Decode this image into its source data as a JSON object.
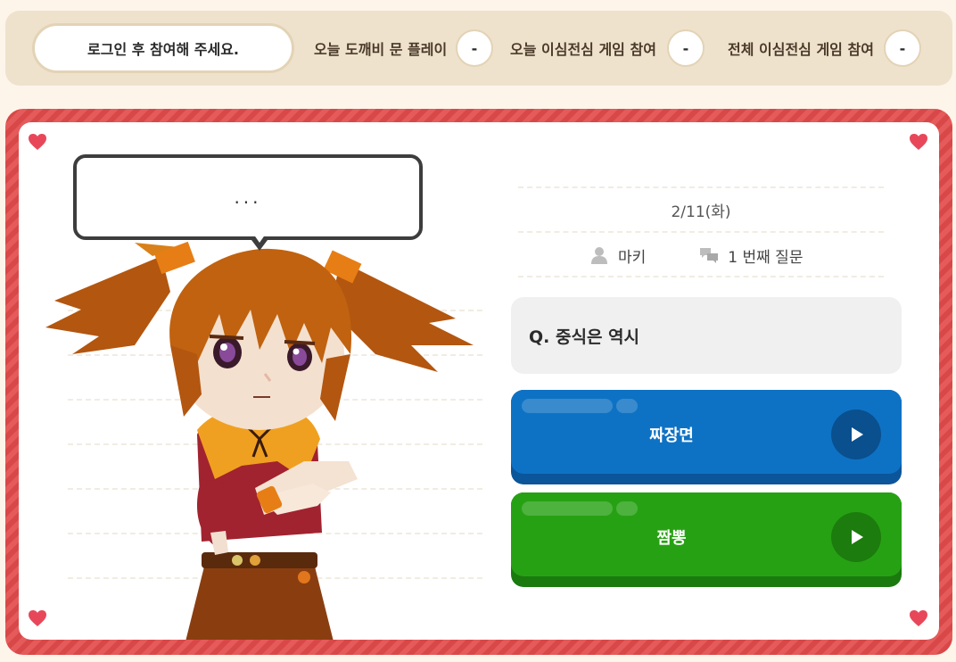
{
  "topbar": {
    "login_button": "로그인 후 참여해 주세요.",
    "stats": [
      {
        "label": "오늘 도깨비 문 플레이",
        "value": "-"
      },
      {
        "label": "오늘 이심전심 게임 참여",
        "value": "-"
      },
      {
        "label": "전체 이심전심 게임 참여",
        "value": "-"
      }
    ]
  },
  "speech": {
    "text": "..."
  },
  "quiz": {
    "date": "2/11(화)",
    "author": "마키",
    "question_number": "1 번째 질문",
    "question": "Q. 중식은 역시",
    "answers": [
      {
        "label": "짜장면",
        "color": "#0e72c4"
      },
      {
        "label": "짬뽕",
        "color": "#27a114"
      }
    ]
  },
  "colors": {
    "frame": "#e55a5a",
    "topbar_bg": "#efe2cc",
    "page_bg": "#fdf5ea"
  },
  "icons": {
    "author": "user-icon",
    "question": "chat-bubbles-icon",
    "answer_action": "play-icon",
    "corner": "heart-icon"
  }
}
